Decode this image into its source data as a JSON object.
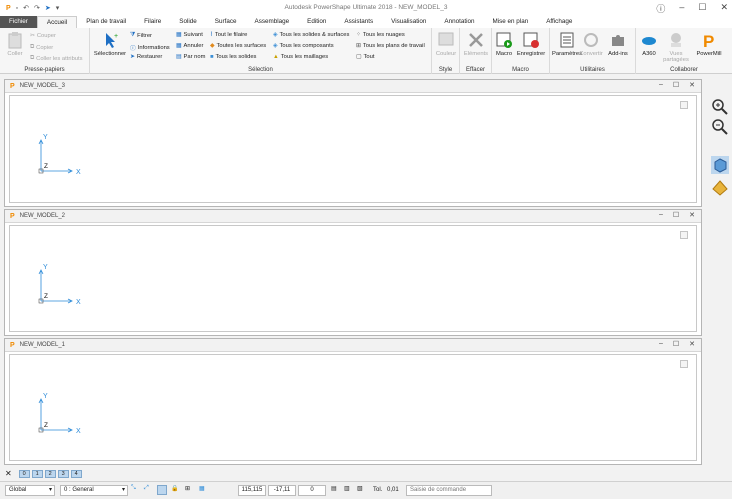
{
  "app": {
    "title": "Autodesk PowerShape Ultimate 2018 - NEW_MODEL_3"
  },
  "tabs": [
    "Fichier",
    "Accueil",
    "Plan de travail",
    "Filaire",
    "Solide",
    "Surface",
    "Assemblage",
    "Edition",
    "Assistants",
    "Visualisation",
    "Annotation",
    "Mise en plan",
    "Affichage"
  ],
  "ribbon": {
    "clipboard": {
      "label": "Presse-papiers",
      "coller": "Coller",
      "couper": "Couper",
      "copier": "Copier",
      "coller_attr": "Coller les attributs"
    },
    "selection": {
      "label": "Sélection",
      "selectionner": "Sélectionner",
      "filtrer": "Filtrer",
      "informations": "Informations",
      "restaurer": "Restaurer",
      "suivant": "Suivant",
      "annuler": "Annuler",
      "par_nom": "Par nom",
      "tout_filaire": "Tout le filaire",
      "toutes_surfaces": "Toutes les surfaces",
      "tous_solides": "Tous les solides",
      "solides_surfaces": "Tous les solides & surfaces",
      "composants": "Tous les composants",
      "maillages": "Tous les maillages",
      "nuages": "Tous les nuages",
      "plans": "Tous les plans de travail",
      "tout": "Tout"
    },
    "style": {
      "label": "Style",
      "couleur": "Couleur"
    },
    "effacer": {
      "label": "Effacer",
      "elements": "Eléments"
    },
    "macro": {
      "label": "Macro",
      "macro": "Macro",
      "enregistrer": "Enregistrer"
    },
    "utilitaires": {
      "label": "Utilitaires",
      "parametres": "Paramètres",
      "convertir": "Convertir",
      "addins": "Add-ins"
    },
    "collaborer": {
      "label": "Collaborer",
      "a360": "A360",
      "vues": "Vues partagées",
      "powermill": "PowerMill"
    }
  },
  "windows": [
    {
      "title": "NEW_MODEL_3",
      "axis_x": "X",
      "axis_y": "Y",
      "axis_z": "Z"
    },
    {
      "title": "NEW_MODEL_2",
      "axis_x": "X",
      "axis_y": "Y",
      "axis_z": "Z"
    },
    {
      "title": "NEW_MODEL_1",
      "axis_x": "X",
      "axis_y": "Y",
      "axis_z": "Z"
    }
  ],
  "model_tabs": [
    "0",
    "1",
    "2",
    "3",
    "4"
  ],
  "status": {
    "workplane": "Global",
    "level": "0 : General",
    "coord_x": "115,115",
    "coord_y": "-17,11",
    "coord_z": "0",
    "tol_label": "Tol.",
    "tol_value": "0,01",
    "command_placeholder": "Saisie de commande"
  }
}
